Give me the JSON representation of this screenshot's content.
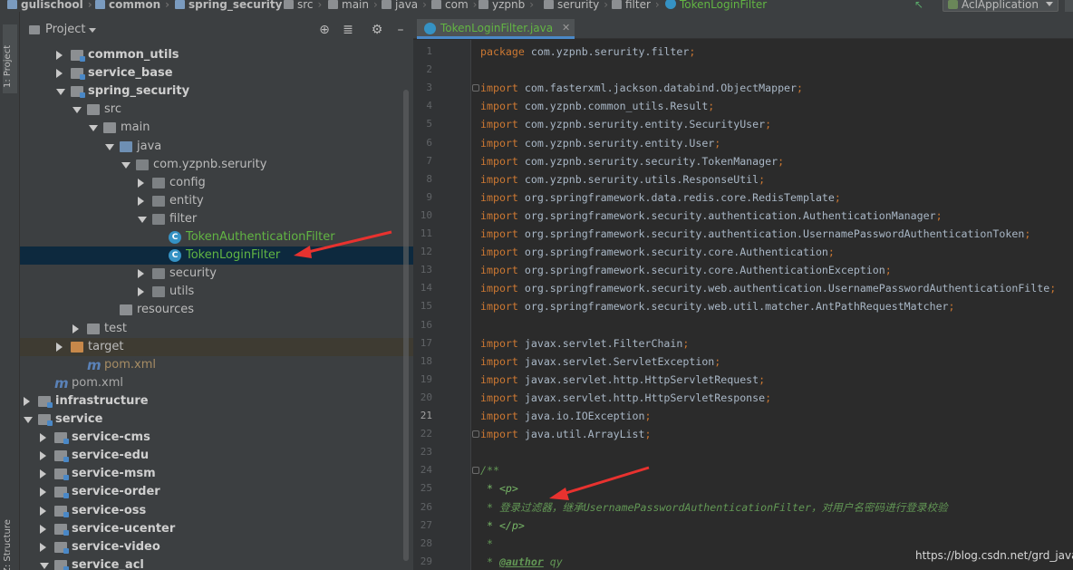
{
  "navbar": {
    "crumbs": [
      {
        "label": "gulischool",
        "icon": "module",
        "bold": true
      },
      {
        "label": "common",
        "icon": "module",
        "bold": true
      },
      {
        "label": "spring_security",
        "icon": "module",
        "bold": true
      },
      {
        "label": "src",
        "icon": "dir"
      },
      {
        "label": "main",
        "icon": "dir"
      },
      {
        "label": "java",
        "icon": "dir"
      },
      {
        "label": "com",
        "icon": "dir"
      },
      {
        "label": "yzpnb",
        "icon": "dir"
      },
      {
        "label": "serurity",
        "icon": "dir"
      },
      {
        "label": "filter",
        "icon": "dir"
      },
      {
        "label": "TokenLoginFilter",
        "icon": "class"
      }
    ],
    "run_config": "AclApplication"
  },
  "tool_stripe": {
    "project_tab": "1: Project",
    "structure_tab": "Z: Structure"
  },
  "project_panel": {
    "title": "Project",
    "header_buttons": [
      "locate-icon",
      "collapse-icon",
      "gear-icon",
      "minimize-icon"
    ],
    "tree": [
      {
        "label": "common_utils",
        "icon": "module",
        "style": "bold",
        "expanded": false
      },
      {
        "label": "service_base",
        "icon": "module",
        "style": "bold",
        "expanded": false
      },
      {
        "label": "spring_security",
        "icon": "module",
        "style": "bold",
        "expanded": true
      },
      {
        "label": "src",
        "icon": "folder",
        "style": "normal",
        "expanded": true
      },
      {
        "label": "main",
        "icon": "folder",
        "style": "normal",
        "expanded": true
      },
      {
        "label": "java",
        "icon": "folder-blue",
        "style": "normal",
        "expanded": true
      },
      {
        "label": "com.yzpnb.serurity",
        "icon": "package",
        "style": "normal",
        "expanded": true
      },
      {
        "label": "config",
        "icon": "package",
        "style": "normal",
        "expanded": false
      },
      {
        "label": "entity",
        "icon": "package",
        "style": "normal",
        "expanded": false
      },
      {
        "label": "filter",
        "icon": "package",
        "style": "normal",
        "expanded": true
      },
      {
        "label": "TokenAuthenticationFilter",
        "icon": "class",
        "style": "green",
        "expanded": null
      },
      {
        "label": "TokenLoginFilter",
        "icon": "class",
        "style": "green",
        "expanded": null,
        "selected": true
      },
      {
        "label": "security",
        "icon": "package",
        "style": "normal",
        "expanded": false
      },
      {
        "label": "utils",
        "icon": "package",
        "style": "normal",
        "expanded": false
      },
      {
        "label": "resources",
        "icon": "folder",
        "style": "normal",
        "expanded": null
      },
      {
        "label": "test",
        "icon": "folder",
        "style": "normal",
        "expanded": false
      },
      {
        "label": "target",
        "icon": "folder-orange",
        "style": "normal",
        "expanded": false,
        "excluded": true
      },
      {
        "label": "pom.xml",
        "icon": "maven",
        "style": "orange",
        "expanded": null
      },
      {
        "label": "pom.xml",
        "icon": "maven",
        "style": "muted",
        "expanded": null
      },
      {
        "label": "infrastructure",
        "icon": "module",
        "style": "bold",
        "expanded": false
      },
      {
        "label": "service",
        "icon": "module",
        "style": "bold",
        "expanded": true
      },
      {
        "label": "service-cms",
        "icon": "module",
        "style": "bold",
        "expanded": false
      },
      {
        "label": "service-edu",
        "icon": "module",
        "style": "bold",
        "expanded": false
      },
      {
        "label": "service-msm",
        "icon": "module",
        "style": "bold",
        "expanded": false
      },
      {
        "label": "service-order",
        "icon": "module",
        "style": "bold",
        "expanded": false
      },
      {
        "label": "service-oss",
        "icon": "module",
        "style": "bold",
        "expanded": false
      },
      {
        "label": "service-ucenter",
        "icon": "module",
        "style": "bold",
        "expanded": false
      },
      {
        "label": "service-video",
        "icon": "module",
        "style": "bold",
        "expanded": false
      },
      {
        "label": "service_acl",
        "icon": "module",
        "style": "bold",
        "expanded": true
      }
    ]
  },
  "editor": {
    "tab_label": "TokenLoginFilter.java",
    "current_line": 21,
    "lines": [
      {
        "n": 1,
        "type": "package",
        "text": "com.yzpnb.serurity.filter"
      },
      {
        "n": 2,
        "type": "blank"
      },
      {
        "n": 3,
        "type": "import",
        "text": "com.fasterxml.jackson.databind.ObjectMapper",
        "fold": true
      },
      {
        "n": 4,
        "type": "import",
        "text": "com.yzpnb.common_utils.Result"
      },
      {
        "n": 5,
        "type": "import",
        "text": "com.yzpnb.serurity.entity.SecurityUser"
      },
      {
        "n": 6,
        "type": "import",
        "text": "com.yzpnb.serurity.entity.User"
      },
      {
        "n": 7,
        "type": "import",
        "text": "com.yzpnb.serurity.security.TokenManager"
      },
      {
        "n": 8,
        "type": "import",
        "text": "com.yzpnb.serurity.utils.ResponseUtil"
      },
      {
        "n": 9,
        "type": "import",
        "text": "org.springframework.data.redis.core.RedisTemplate"
      },
      {
        "n": 10,
        "type": "import",
        "text": "org.springframework.security.authentication.AuthenticationManager"
      },
      {
        "n": 11,
        "type": "import",
        "text": "org.springframework.security.authentication.UsernamePasswordAuthenticationToken"
      },
      {
        "n": 12,
        "type": "import",
        "text": "org.springframework.security.core.Authentication"
      },
      {
        "n": 13,
        "type": "import",
        "text": "org.springframework.security.core.AuthenticationException"
      },
      {
        "n": 14,
        "type": "import",
        "text": "org.springframework.security.web.authentication.UsernamePasswordAuthenticationFilte"
      },
      {
        "n": 15,
        "type": "import",
        "text": "org.springframework.security.web.util.matcher.AntPathRequestMatcher"
      },
      {
        "n": 16,
        "type": "blank"
      },
      {
        "n": 17,
        "type": "import",
        "text": "javax.servlet.FilterChain"
      },
      {
        "n": 18,
        "type": "import",
        "text": "javax.servlet.ServletException"
      },
      {
        "n": 19,
        "type": "import",
        "text": "javax.servlet.http.HttpServletRequest"
      },
      {
        "n": 20,
        "type": "import",
        "text": "javax.servlet.http.HttpServletResponse"
      },
      {
        "n": 21,
        "type": "import",
        "text": "java.io.IOException"
      },
      {
        "n": 22,
        "type": "import",
        "text": "java.util.ArrayList",
        "fold": true
      },
      {
        "n": 23,
        "type": "blank"
      },
      {
        "n": 24,
        "type": "comment",
        "text": "/**",
        "fold": true
      },
      {
        "n": 25,
        "type": "comment-tag",
        "text": " * <p>"
      },
      {
        "n": 26,
        "type": "comment",
        "text": " * 登录过滤器，继承UsernamePasswordAuthenticationFilter，对用户名密码进行登录校验"
      },
      {
        "n": 27,
        "type": "comment-tag",
        "text": " * </p>"
      },
      {
        "n": 28,
        "type": "comment",
        "text": " *"
      },
      {
        "n": 29,
        "type": "comment-author",
        "prefix": " * ",
        "tag": "@author",
        "text": " qy"
      }
    ],
    "keywords": {
      "package": "package",
      "import": "import"
    }
  },
  "watermark": "https://blog.csdn.net/grd_java",
  "colors": {
    "keyword": "#cc7832",
    "code_text": "#a9b7c6",
    "comment": "#629755",
    "class_green": "#62b543",
    "selection": "#0d293e",
    "arrow_red": "#e8322f"
  }
}
